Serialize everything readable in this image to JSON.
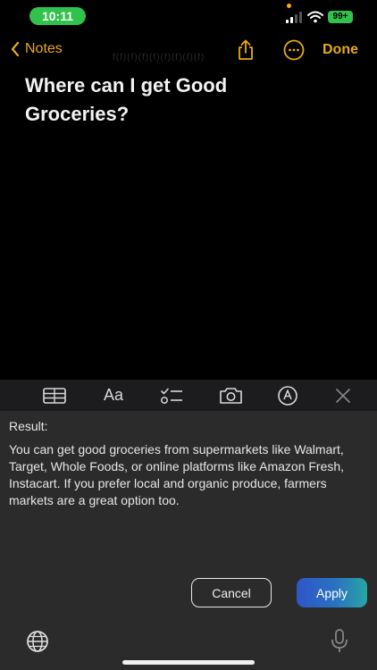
{
  "status": {
    "time": "10:11",
    "battery": "99+"
  },
  "nav": {
    "back_label": "Notes",
    "done_label": "Done",
    "ghost_text": "f(f)(f)(f)(f)(f)(f)(f)(f)"
  },
  "note": {
    "title": "Where can I get Good Groceries?"
  },
  "toolbar": {
    "format_label": "Aa"
  },
  "result": {
    "label": "Result:",
    "text": "You can get good groceries from supermarkets like Walmart, Target, Whole Foods, or online platforms like Amazon Fresh, Instacart. If you prefer local and organic produce, farmers markets are a great option too."
  },
  "actions": {
    "cancel_label": "Cancel",
    "apply_label": "Apply"
  },
  "colors": {
    "accent": "#e9a91a",
    "status_green": "#30c24a",
    "panel_bg": "#2b2b2b"
  }
}
